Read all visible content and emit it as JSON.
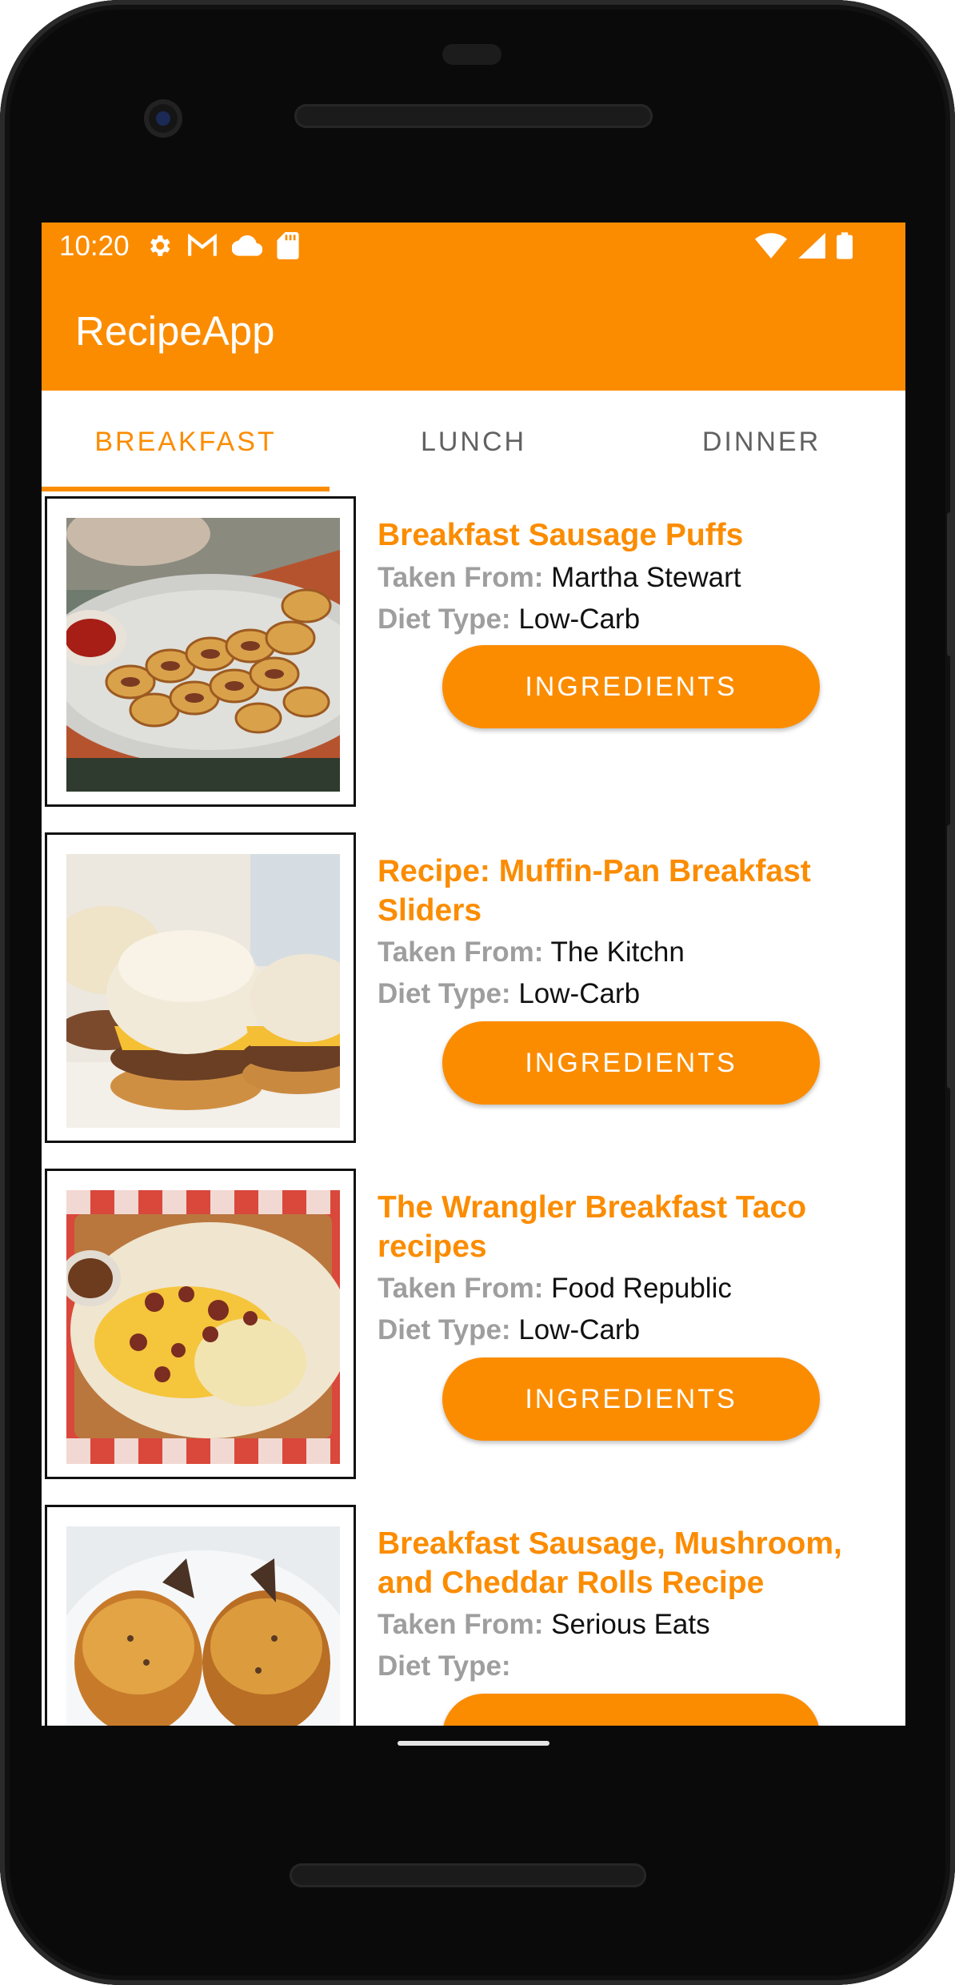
{
  "status_bar": {
    "time": "10:20",
    "left_icons": [
      "gear-icon",
      "gmail-icon",
      "cloud-icon",
      "sd-card-icon"
    ],
    "right_icons": [
      "wifi-icon",
      "signal-icon",
      "battery-icon"
    ]
  },
  "app_bar": {
    "title": "RecipeApp"
  },
  "tabs": [
    {
      "label": "BREAKFAST",
      "active": true
    },
    {
      "label": "LUNCH",
      "active": false
    },
    {
      "label": "DINNER",
      "active": false
    }
  ],
  "labels": {
    "taken_from": "Taken From:",
    "diet_type": "Diet Type:"
  },
  "recipes": [
    {
      "title": "Breakfast Sausage Puffs",
      "source": "Martha Stewart",
      "diet": "Low-Carb",
      "button": "INGREDIENTS",
      "image": "sausage-puffs-photo"
    },
    {
      "title": "Recipe: Muffin-Pan Breakfast Sliders",
      "source": "The Kitchn",
      "diet": "Low-Carb",
      "button": "INGREDIENTS",
      "image": "breakfast-sliders-photo"
    },
    {
      "title": "The Wrangler Breakfast Taco recipes",
      "source": "Food Republic",
      "diet": "Low-Carb",
      "button": "INGREDIENTS",
      "image": "breakfast-taco-photo"
    },
    {
      "title": "Breakfast Sausage, Mushroom, and Cheddar Rolls Recipe",
      "source": "Serious Eats",
      "diet": "",
      "button": "",
      "image": "sausage-rolls-photo"
    }
  ],
  "colors": {
    "primary": "#fb8c00",
    "label_gray": "#9e9e9e",
    "tab_inactive": "#616161"
  }
}
